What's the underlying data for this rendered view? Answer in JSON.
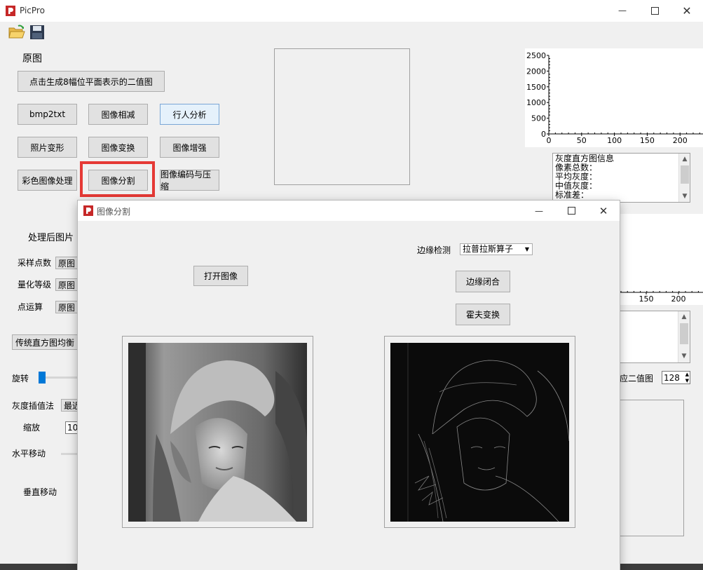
{
  "main": {
    "title": "PicPro",
    "toolbar": {
      "open_icon": "open-folder-icon",
      "save_icon": "save-floppy-icon"
    },
    "original_label": "原图",
    "btn_bitplane": "点击生成8幅位平面表示的二值图",
    "btn_bmp2txt": "bmp2txt",
    "btn_subtract": "图像相减",
    "btn_pedestrian": "行人分析",
    "btn_photo_deform": "照片变形",
    "btn_transform": "图像变换",
    "btn_enhance": "图像增强",
    "btn_color": "彩色图像处理",
    "btn_segment": "图像分割",
    "btn_encode": "图像编码与压缩",
    "processed_label": "处理后图片",
    "sample_label": "采样点数",
    "sample_value": "原图",
    "quantize_label": "量化等级",
    "quantize_value": "原图",
    "pointop_label": "点运算",
    "pointop_value": "原图",
    "btn_hist_eq": "传统直方图均衡",
    "rotate_label": "旋转",
    "interp_label": "灰度插值法",
    "interp_value": "最近",
    "scale_label": "缩放",
    "scale_value": "10",
    "hmove_label": "水平移动",
    "vmove_label": "垂直移动",
    "hist_info": [
      "灰度直方图信息",
      "像素总数：",
      "平均灰度：",
      "中值灰度：",
      "标准差："
    ],
    "adaptive_label": "应二值图",
    "threshold_value": "128",
    "highlight_color": "#e53935"
  },
  "chart_data": [
    {
      "type": "bar",
      "title": "",
      "xlabel": "",
      "ylabel": "",
      "x_ticks": [
        "0",
        "50",
        "100",
        "150",
        "200"
      ],
      "y_ticks": [
        "0",
        "500",
        "1000",
        "1500",
        "2000",
        "2500"
      ],
      "xlim": [
        0,
        235
      ],
      "ylim": [
        0,
        2500
      ],
      "values": []
    },
    {
      "type": "bar",
      "title": "",
      "xlabel": "",
      "ylabel": "",
      "x_ticks": [
        "150",
        "200"
      ],
      "values": []
    }
  ],
  "dialog": {
    "title": "图像分割",
    "edge_label": "边缘检测",
    "edge_method": "拉普拉斯算子",
    "btn_open": "打开图像",
    "btn_edge_close": "边缘闭合",
    "btn_hough": "霍夫变换"
  }
}
